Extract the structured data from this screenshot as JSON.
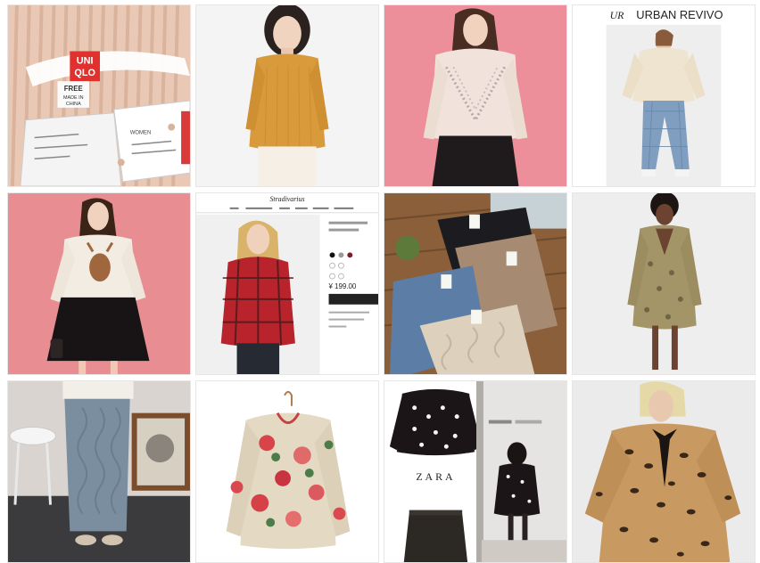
{
  "gallery": {
    "tiles": [
      {
        "id": "t1",
        "desc": "uniqlo-label"
      },
      {
        "id": "t2",
        "desc": "mustard-sweater"
      },
      {
        "id": "t3",
        "desc": "pink-studded-sweater"
      },
      {
        "id": "t4",
        "desc": "urban-revivo-look"
      },
      {
        "id": "t5",
        "desc": "deer-sweater"
      },
      {
        "id": "t6",
        "desc": "stradivarius-product-page"
      },
      {
        "id": "t7",
        "desc": "knit-skirts"
      },
      {
        "id": "t8",
        "desc": "snakeskin-dress"
      },
      {
        "id": "t9",
        "desc": "knit-midi-skirt"
      },
      {
        "id": "t10",
        "desc": "floral-blouse"
      },
      {
        "id": "t11",
        "desc": "zara-polka-dot"
      },
      {
        "id": "t12",
        "desc": "leopard-dress"
      }
    ]
  },
  "label": {
    "brand_top": "UNI",
    "brand_bottom": "QLO",
    "size": "FREE",
    "made_in_1": "MADE IN",
    "made_in_2": "CHINA",
    "tag_women": "WOMEN"
  },
  "urban_revivo": {
    "logo_mark": "UR",
    "name": "URBAN REVIVO"
  },
  "stradivarius": {
    "logo": "Stradivarius",
    "price": "¥ 199.00"
  },
  "zara": {
    "logo": "ZARA"
  },
  "colors": {
    "pink_bg": "#ec8f9a",
    "mustard": "#d99a3c",
    "tag_red": "#e0312f",
    "plaid_red": "#b8232c",
    "leopard": "#c89a62"
  }
}
